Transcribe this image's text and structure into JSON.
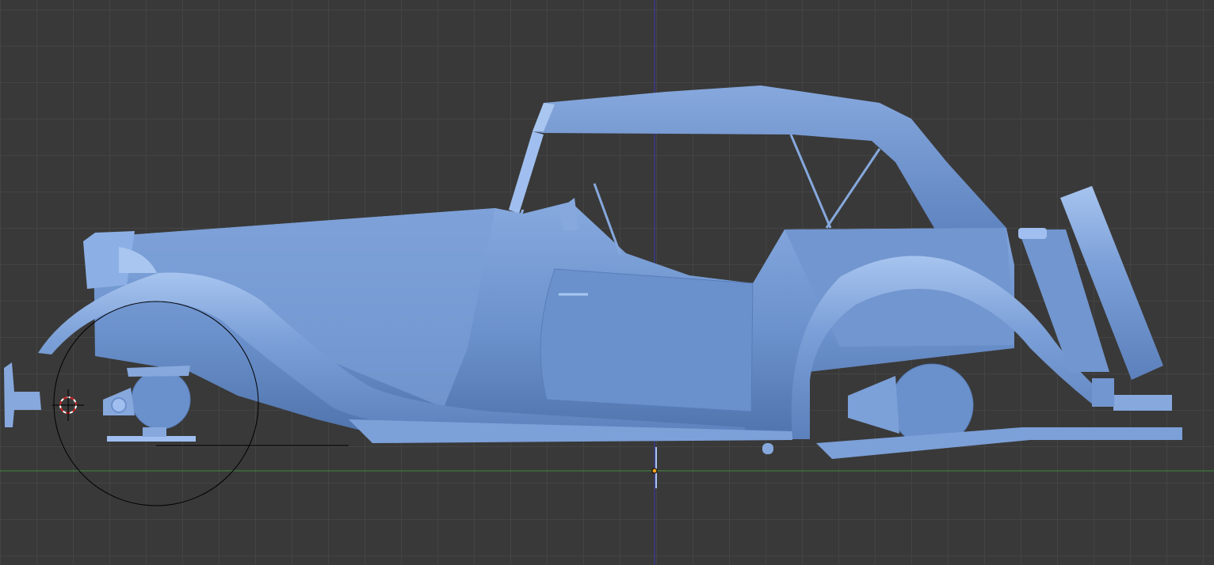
{
  "viewport": {
    "mode": "3d-viewport-side-view",
    "background_color": "#393939",
    "grid_color": "#444444",
    "x_axis_color": "#3e8a3e",
    "z_axis_color": "#3a3ab0",
    "model_color": "#6f96d2",
    "model_shadow_color": "#4f74ad",
    "model_highlight_color": "#a9c6f0"
  },
  "scene": {
    "object": "car-model",
    "tools": [
      "3d-cursor",
      "brush-circle",
      "object-origin"
    ]
  }
}
